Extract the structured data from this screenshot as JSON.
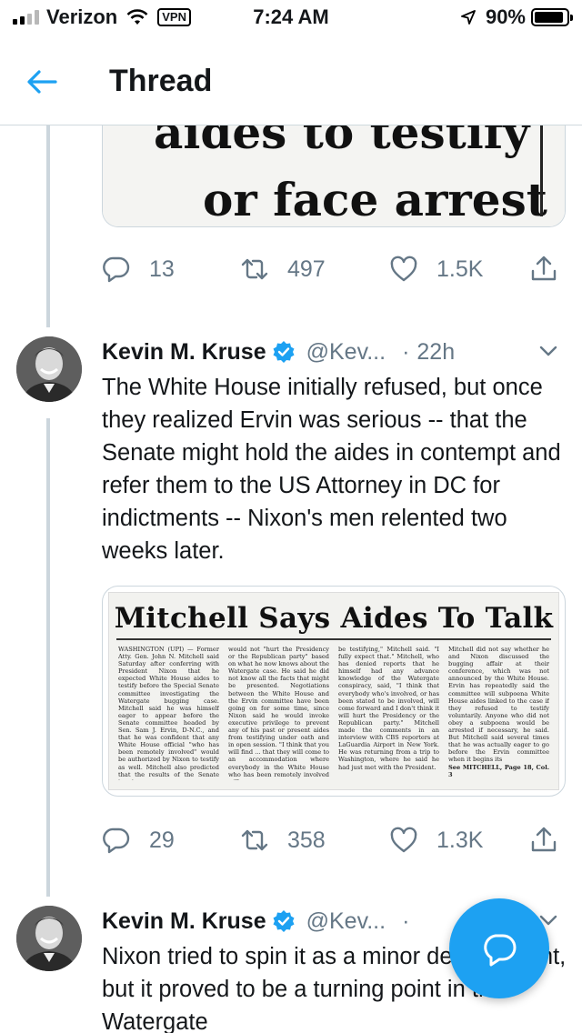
{
  "status_bar": {
    "carrier": "Verizon",
    "vpn": "VPN",
    "time": "7:24 AM",
    "battery": "90%",
    "battery_level": 0.9
  },
  "header": {
    "title": "Thread",
    "back_icon": "back-arrow-icon"
  },
  "clip_top": {
    "headline_line1": "aides to testify",
    "headline_line2": "or face arrest"
  },
  "tweet0_actions": {
    "replies": "13",
    "retweets": "497",
    "likes": "1.5K"
  },
  "tweet1": {
    "name": "Kevin M. Kruse",
    "handle": "@Kev...",
    "dot": "·",
    "time": "22h",
    "text": "The White House initially refused, but once they realized Ervin was serious -- that the Senate might hold the aides in contempt and refer them to the US Attorney in DC for indictments -- Nixon's men relented two weeks later.",
    "clip": {
      "headline": "Mitchell Says Aides To Talk",
      "col1": "WASHINGTON (UPI) — Former Atty. Gen. John N. Mitchell said Saturday after conferring with President Nixon that he expected White House aides to testify before the Special Senate committee investigating the Watergate bugging case. Mitchell said he was himself eager to appear before the Senate committee headed by Sen. Sam J. Ervin, D-N.C., and that he was confident that any White House official \"who has been remotely involved\" would be authorized by Nixon to testify as well. Mitchell also predicted that the results of the Senate inquiry",
      "col2": "would not \"hurt the Presidency or the Republican party\" based on what he now knows about the Watergate case. He said he did not know all the facts that might be presented. Negotiations between the White House and the Ervin committee have been going on for some time, since Nixon said he would invoke executive privilege to prevent any of his past or present aides from testifying under oath and in open session. \"I think that you will find ... that they will come to an accommodation where everybody in the White House who has been remotely involved will",
      "col3": "be testifying,\" Mitchell said. \"I fully expect that.\" Mitchell, who has denied reports that he himself had any advance knowledge of the Watergate conspiracy, said, \"I think that everybody who's involved, or has been stated to be involved, will come forward and I don't think it will hurt the Presidency or the Republican party.\" Mitchell made the comments in an interview with CBS reporters at LaGuardia Airport in New York. He was returning from a trip to Washington, where he said he had just met with the President.",
      "col4": "Mitchell did not say whether he and Nixon discussed the bugging affair at their conference, which was not announced by the White House. Ervin has repeatedly said the committee will subpoena White House aides linked to the case if they refused to testify voluntarily. Anyone who did not obey a subpoena would be arrested if necessary, he said. But Mitchell said several times that he was actually eager to go before the Ervin committee when it begins its",
      "col4_footer": "See MITCHELL, Page 18, Col. 3"
    },
    "actions": {
      "replies": "29",
      "retweets": "358",
      "likes": "1.3K"
    }
  },
  "tweet2": {
    "name": "Kevin M. Kruse",
    "handle": "@Kev...",
    "dot": "·",
    "text": "Nixon tried to spin it as a minor development, but it proved to be a turning point in the Watergate"
  },
  "icons": {
    "reply": "reply-icon",
    "retweet": "retweet-icon",
    "like": "heart-icon",
    "share": "share-icon",
    "verified": "verified-badge-icon",
    "caret": "chevron-down-icon",
    "compose": "compose-reply-icon"
  },
  "colors": {
    "accent": "#1da1f2",
    "muted": "#657786",
    "thread_line": "#ccd6dd"
  }
}
